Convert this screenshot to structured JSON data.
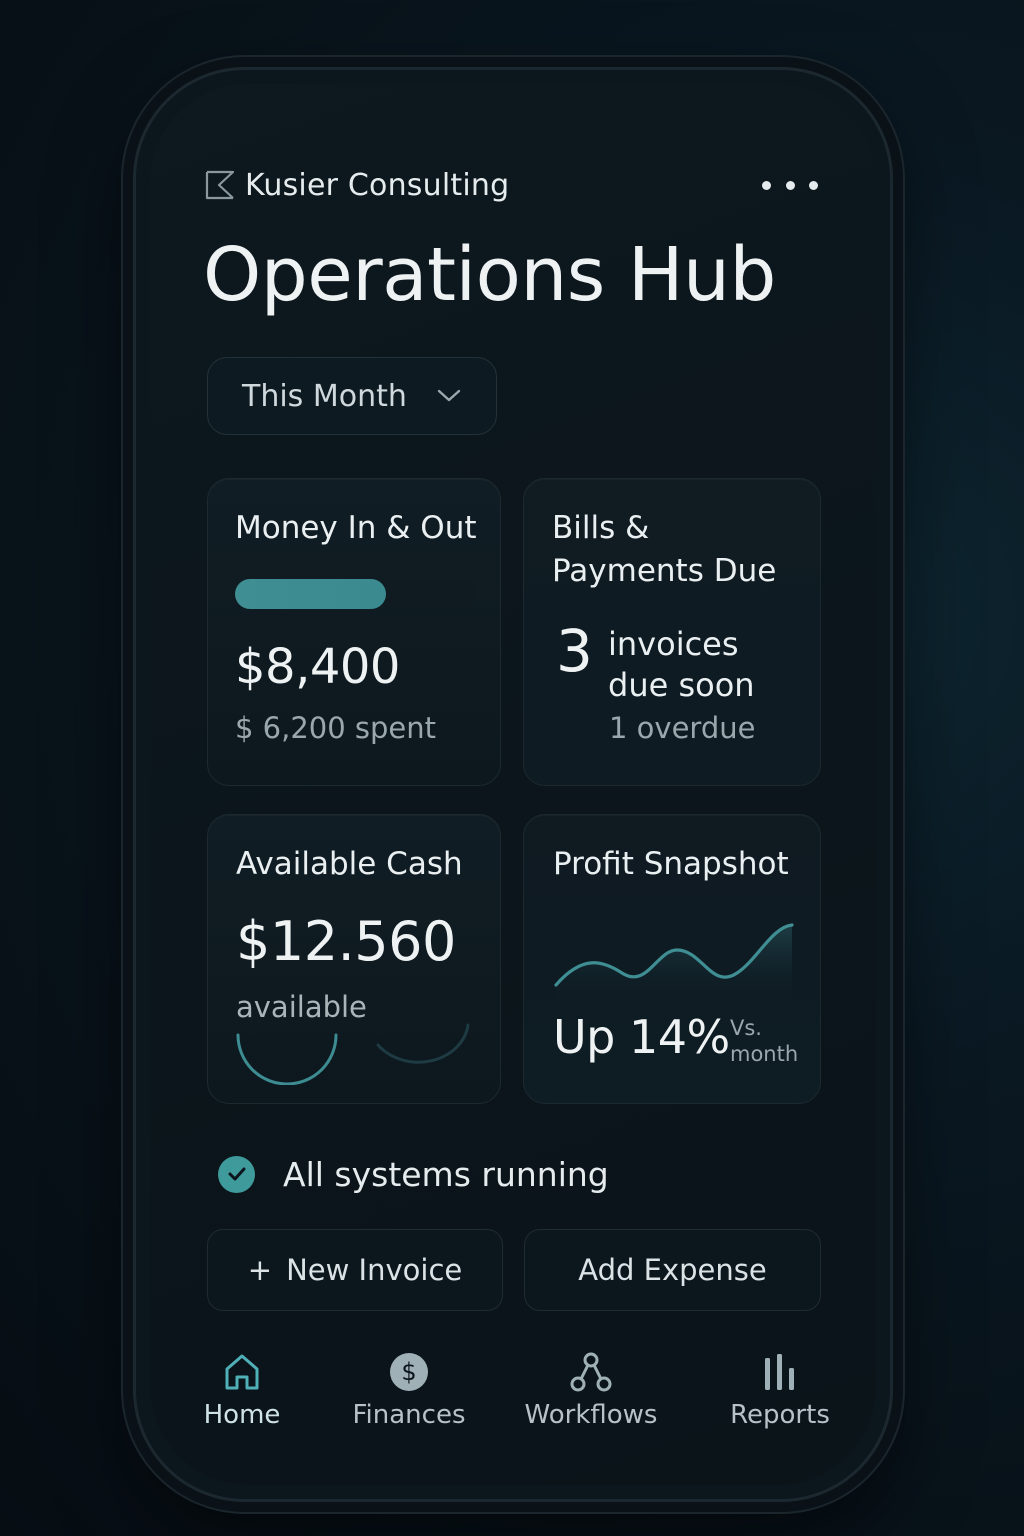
{
  "header": {
    "brand": "Kusier Consulting",
    "more_icon": "more-horizontal-icon",
    "title": "Operations Hub"
  },
  "period_selector": {
    "value": "This Month",
    "icon": "chevron-down-icon"
  },
  "cards": {
    "money": {
      "title": "Money In & Out",
      "progress_fraction": 0.63,
      "amount": "$8,400",
      "spent": "$ 6,200 spent"
    },
    "bills": {
      "title_line1": "Bills &",
      "title_line2": "Payments Due",
      "count": "3",
      "desc_line1": "invoices",
      "desc_line2": "due soon",
      "overdue": "1 overdue"
    },
    "cash": {
      "title": "Available Cash",
      "amount": "$12.560",
      "label": "available"
    },
    "profit": {
      "title": "Profit Snapshot",
      "headline": "Up 14%",
      "compare_line1": "Vs.",
      "compare_line2": "month"
    }
  },
  "status": {
    "text": "All systems running",
    "icon": "check-circle-icon"
  },
  "actions": {
    "new_invoice_prefix": "+",
    "new_invoice": "New Invoice",
    "add_expense": "Add Expense"
  },
  "nav": [
    {
      "label": "Home",
      "icon": "home-icon",
      "active": true
    },
    {
      "label": "Finances",
      "icon": "dollar-icon",
      "active": false
    },
    {
      "label": "Workflows",
      "icon": "workflow-icon",
      "active": false
    },
    {
      "label": "Reports",
      "icon": "bar-chart-icon",
      "active": false
    }
  ],
  "colors": {
    "accent": "#3f9a9b",
    "background": "#0b151b",
    "text": "#e6ecee",
    "muted": "#9aa7ad"
  }
}
